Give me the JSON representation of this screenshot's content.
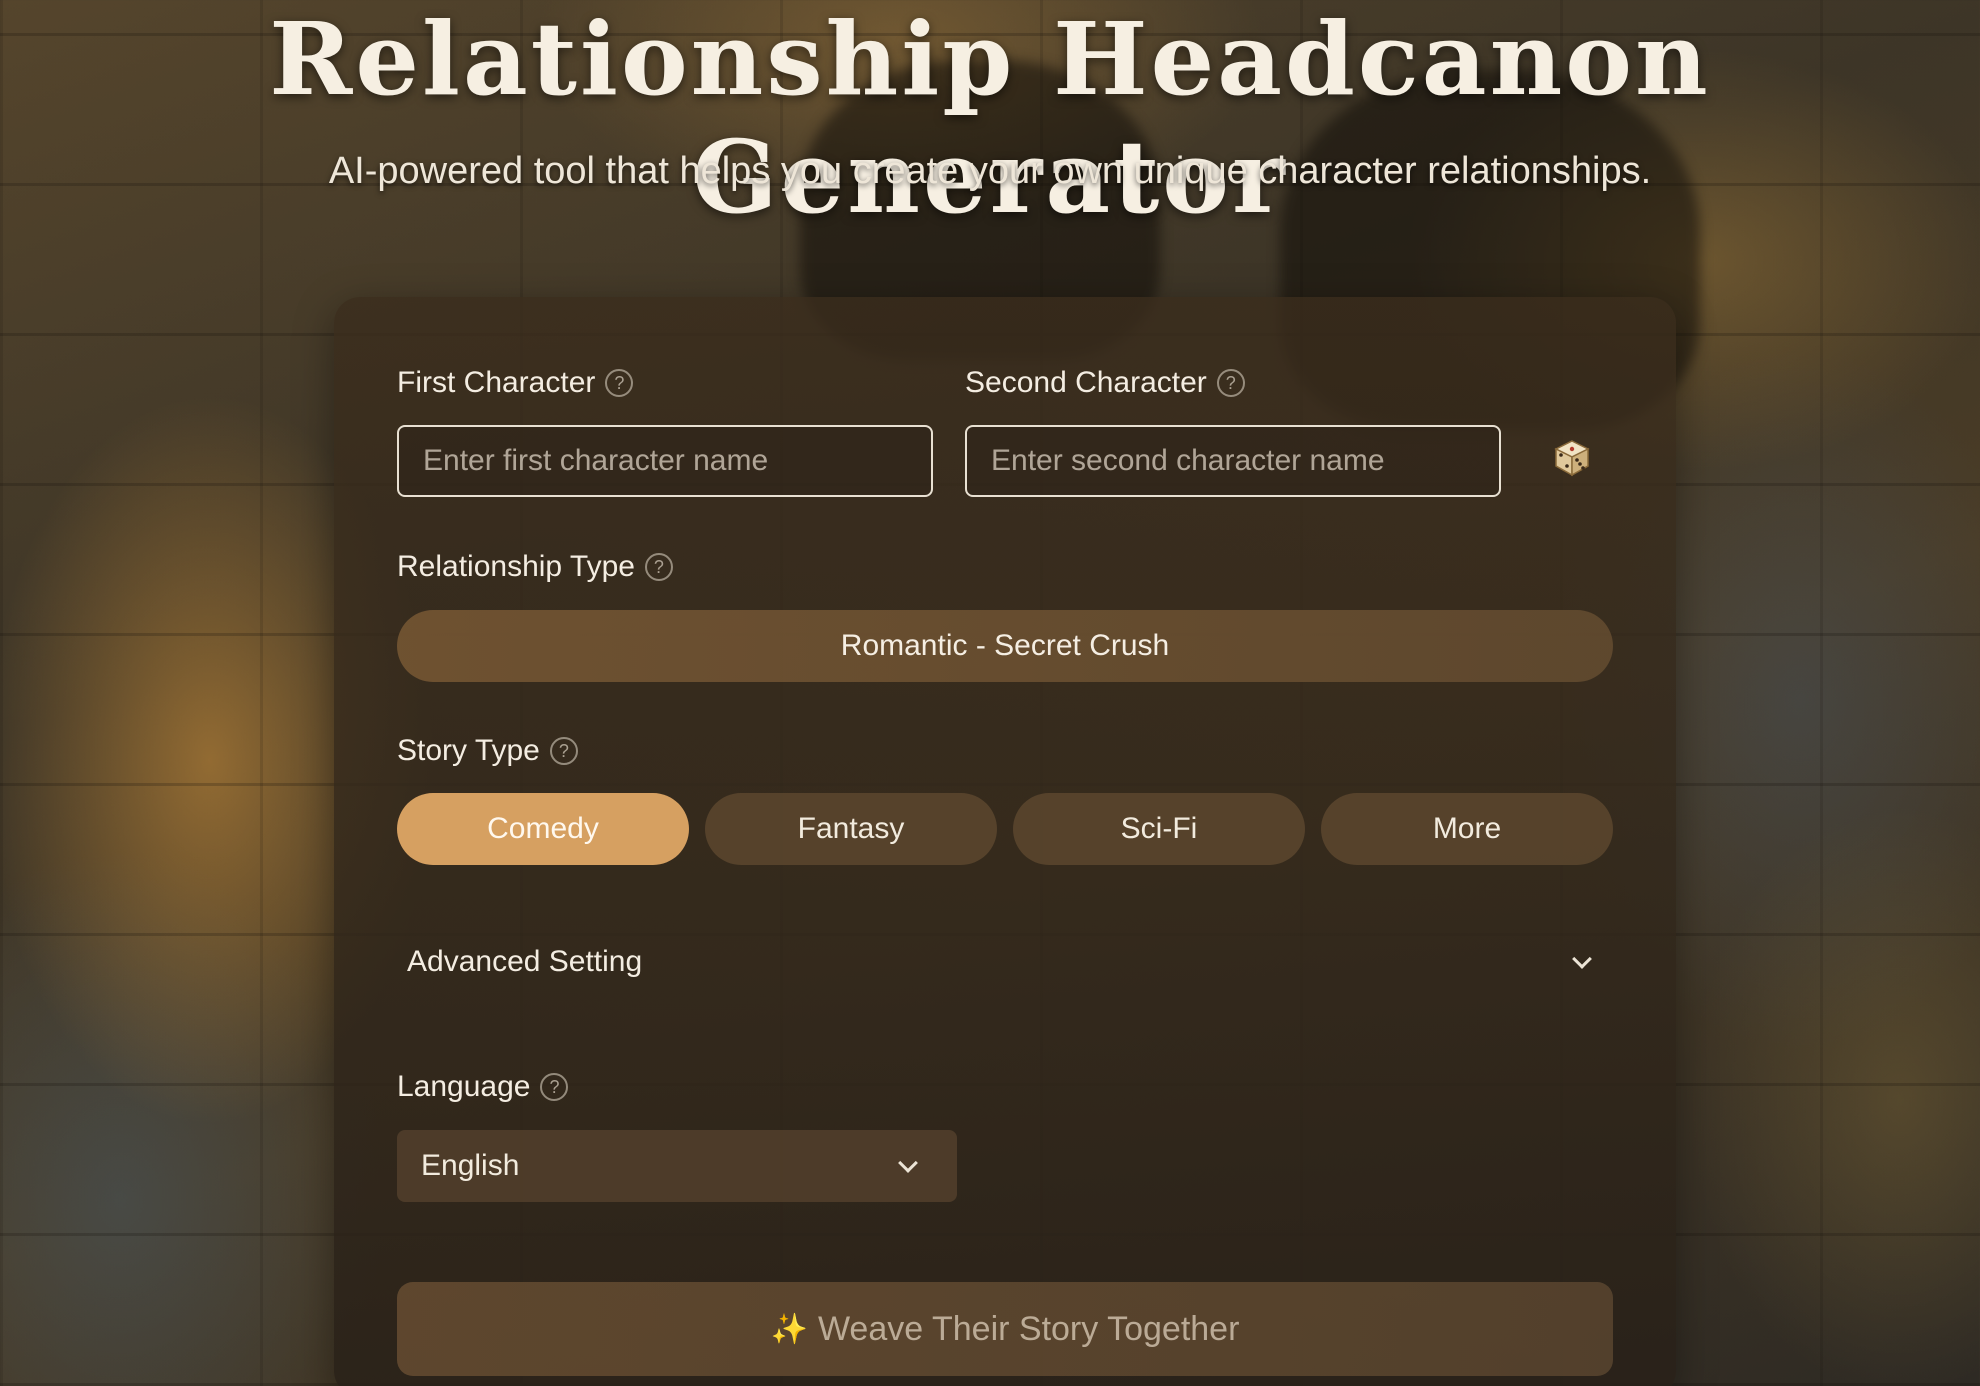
{
  "header": {
    "title": "Relationship Headcanon Generator",
    "subtitle": "AI-powered tool that helps you create your own unique character relationships."
  },
  "form": {
    "first_character": {
      "label": "First Character",
      "placeholder": "Enter first character name",
      "value": ""
    },
    "second_character": {
      "label": "Second Character",
      "placeholder": "Enter second character name",
      "value": ""
    },
    "randomize_icon": "dice-icon",
    "relationship_type": {
      "label": "Relationship Type",
      "selected": "Romantic - Secret Crush"
    },
    "story_type": {
      "label": "Story Type",
      "options": [
        "Comedy",
        "Fantasy",
        "Sci-Fi",
        "More"
      ],
      "selected": "Comedy"
    },
    "advanced_setting": {
      "label": "Advanced Setting",
      "expanded": false
    },
    "language": {
      "label": "Language",
      "selected": "English"
    },
    "submit": {
      "label": "Weave Their Story Together",
      "icon": "sparkle-icon"
    }
  },
  "colors": {
    "accent": "#d6a061",
    "text": "#f4ede2",
    "panel": "#3a2c1c"
  }
}
